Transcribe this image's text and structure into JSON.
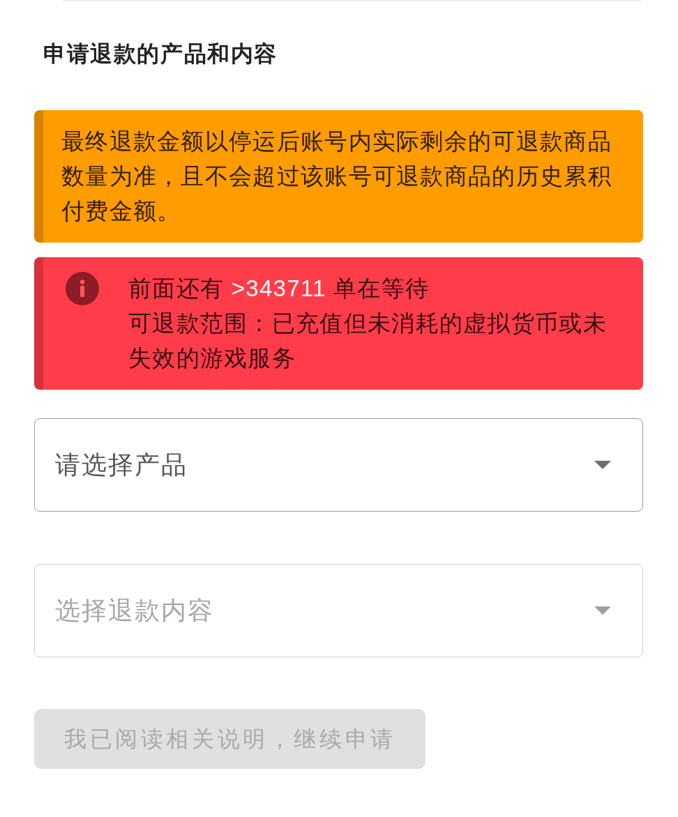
{
  "section": {
    "title": "申请退款的产品和内容"
  },
  "notices": [
    {
      "kind": "warning",
      "paragraphs": [
        {
          "parts": [
            {
              "text": "最终退款金额以停运后账号内实际剩余的可退款商品数量为准，且不会超过该账号可退款商品的历史累积付费金额。",
              "highlight": false
            }
          ]
        }
      ]
    },
    {
      "kind": "error",
      "paragraphs": [
        {
          "parts": [
            {
              "text": "前面还有 ",
              "highlight": false
            },
            {
              "text": ">343711",
              "highlight": true
            },
            {
              "text": " 单在等待",
              "highlight": false
            }
          ]
        },
        {
          "parts": [
            {
              "text": "可退款范围：已充值但未消耗的虚拟货币或未失效的游戏服务",
              "highlight": false
            }
          ]
        }
      ]
    }
  ],
  "selects": [
    {
      "placeholder": "请选择产品",
      "disabled": false
    },
    {
      "placeholder": "选择退款内容",
      "disabled": true
    }
  ],
  "submit_button": {
    "label": "我已阅读相关说明，继续申请",
    "disabled": true
  }
}
